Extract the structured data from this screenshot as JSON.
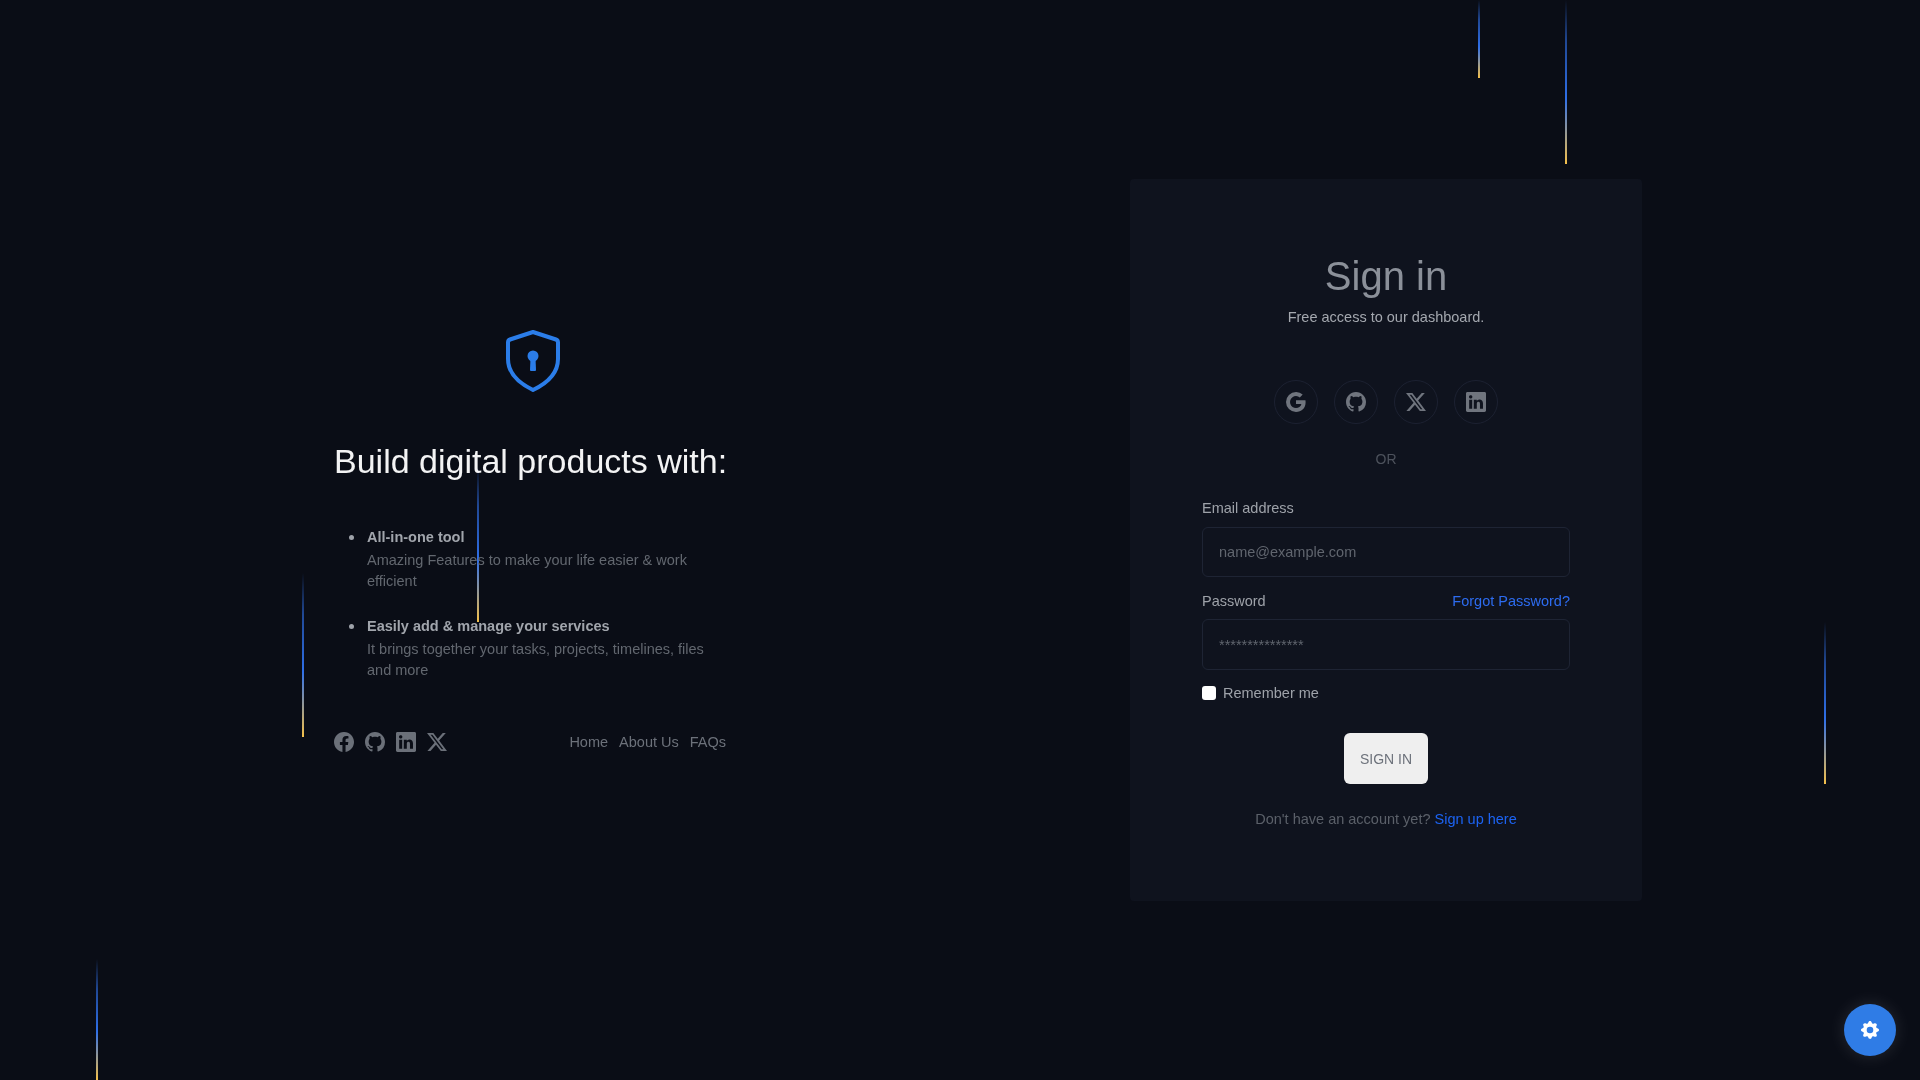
{
  "hero": {
    "heading": "Build digital products with:",
    "features": [
      {
        "title": "All-in-one tool",
        "description": "Amazing Features to make your life easier & work efficient"
      },
      {
        "title": "Easily add & manage your services",
        "description": "It brings together your tasks, projects, timelines, files and more"
      }
    ],
    "footer_links": [
      "Home",
      "About Us",
      "FAQs"
    ]
  },
  "sign_in": {
    "title": "Sign in",
    "subtitle": "Free access to our dashboard.",
    "divider": "OR",
    "email": {
      "label": "Email address",
      "placeholder": "name@example.com"
    },
    "password": {
      "label": "Password",
      "forgot_link": "Forgot Password?",
      "placeholder": "***************"
    },
    "remember_me": {
      "label": "Remember me",
      "checked": false
    },
    "submit": "SIGN IN",
    "signup": {
      "prompt": "Don't have an account yet?",
      "link": "Sign up here"
    }
  }
}
